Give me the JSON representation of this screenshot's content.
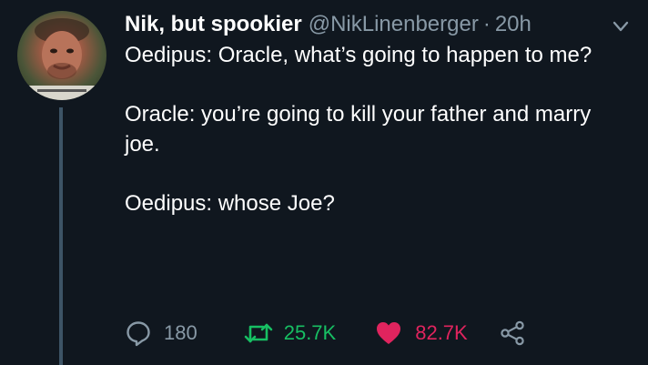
{
  "tweet": {
    "display_name": "Nik, but spookier",
    "handle": "@NikLinenberger",
    "separator": "·",
    "time": "20h",
    "lines": [
      "Oedipus: Oracle, what’s going to happen to me?",
      "Oracle: you’re going to kill your father and marry joe.",
      "Oedipus: whose Joe?"
    ]
  },
  "actions": {
    "reply_count": "180",
    "retweet_count": "25.7K",
    "like_count": "82.7K"
  },
  "icons": {
    "reply": "speech-bubble-icon",
    "retweet": "retweet-arrows-icon",
    "like": "heart-icon",
    "share": "share-nodes-icon",
    "menu": "chevron-down-icon"
  },
  "colors": {
    "background": "#10171f",
    "text": "#ffffff",
    "secondary": "#8899a6",
    "retweet_green": "#17bf63",
    "like_pink": "#e0245e",
    "thread_line": "#3d5466"
  }
}
